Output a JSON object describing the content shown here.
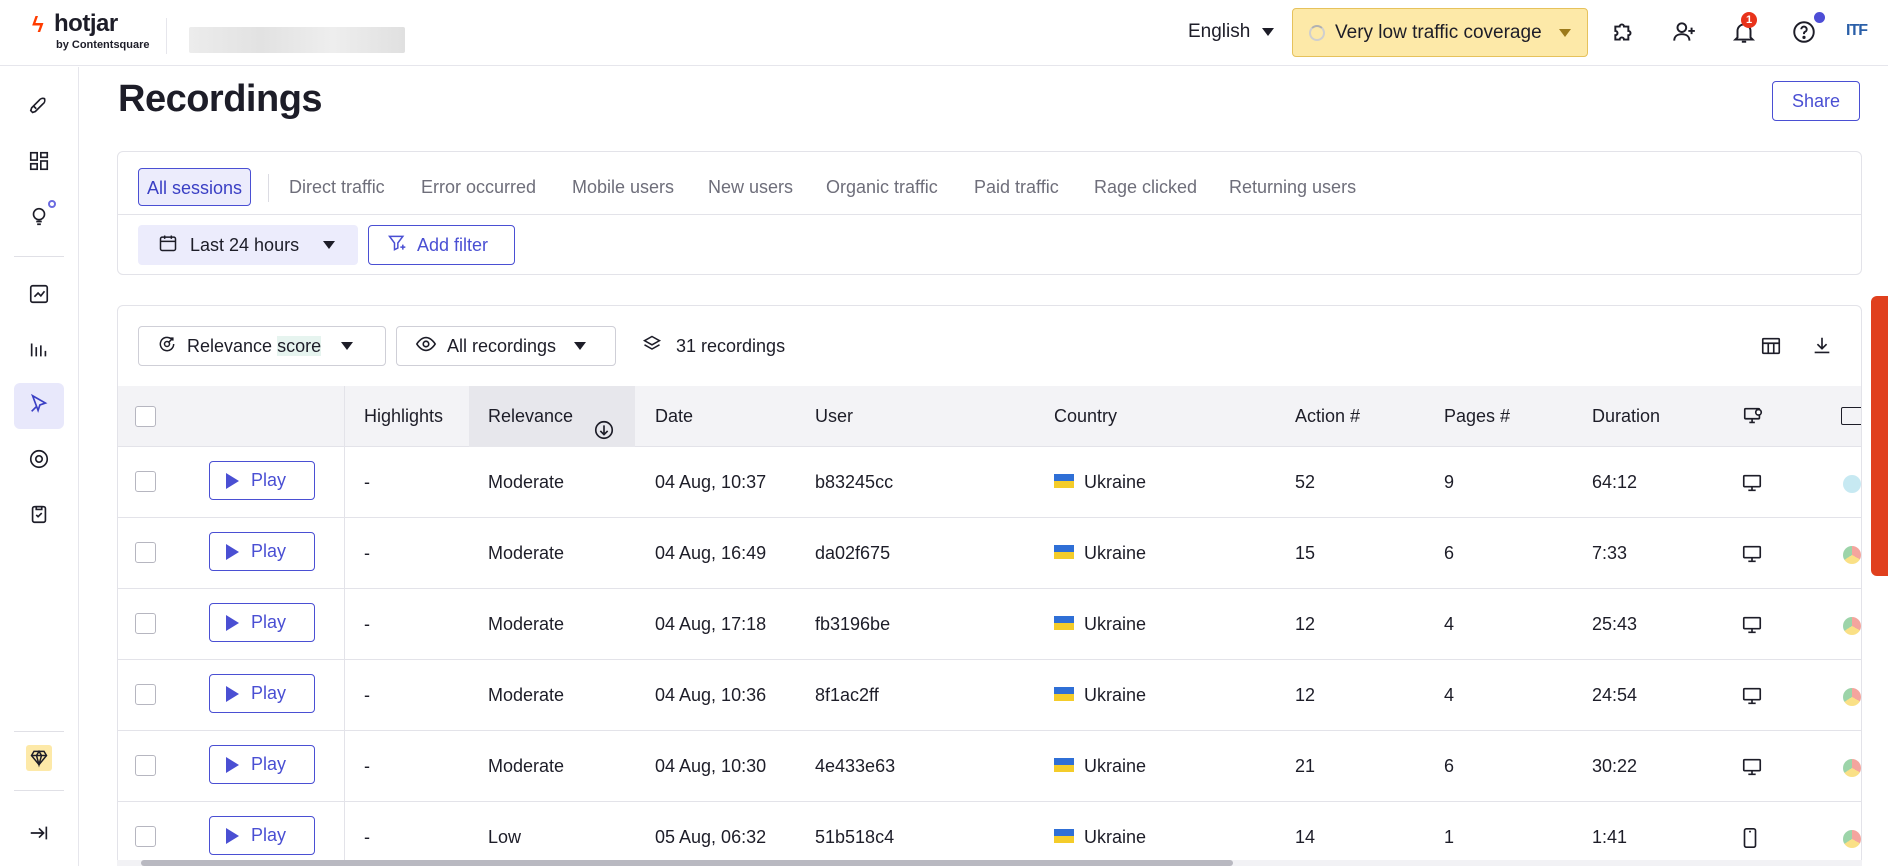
{
  "header": {
    "brand": "hotjar",
    "brand_sub": "by Contentsquare",
    "language": "English",
    "traffic_coverage": "Very low traffic coverage",
    "notifications_count": "1",
    "org_initials": "ITF"
  },
  "sidebar": {
    "items": [
      {
        "icon": "rocket-icon"
      },
      {
        "icon": "dashboard-icon"
      },
      {
        "icon": "lightbulb-icon"
      },
      {
        "icon": "trends-icon"
      },
      {
        "icon": "bar-chart-icon"
      },
      {
        "icon": "recordings-icon",
        "active": true
      },
      {
        "icon": "feedback-icon"
      },
      {
        "icon": "survey-icon"
      },
      {
        "icon": "diamond-icon"
      },
      {
        "icon": "collapse-icon"
      }
    ]
  },
  "page": {
    "title": "Recordings",
    "share_label": "Share"
  },
  "segments": {
    "tabs": [
      "All sessions",
      "Direct traffic",
      "Error occurred",
      "Mobile users",
      "New users",
      "Organic traffic",
      "Paid traffic",
      "Rage clicked",
      "Returning users"
    ],
    "active": "All sessions",
    "date_range": "Last 24 hours",
    "add_filter": "Add filter"
  },
  "toolbar": {
    "sort_label_1": "Relevance",
    "sort_label_2": "score",
    "view_filter": "All recordings",
    "recordings_count": "31 recordings"
  },
  "table": {
    "columns": [
      "Highlights",
      "Relevance",
      "Date",
      "User",
      "Country",
      "Action #",
      "Pages #",
      "Duration"
    ],
    "play_label": "Play",
    "rows": [
      {
        "highlights": "-",
        "relevance": "Moderate",
        "date": "04 Aug, 10:37",
        "user": "b83245cc",
        "country": "Ukraine",
        "actions": "52",
        "pages": "9",
        "duration": "64:12",
        "device": "desktop"
      },
      {
        "highlights": "-",
        "relevance": "Moderate",
        "date": "04 Aug, 16:49",
        "user": "da02f675",
        "country": "Ukraine",
        "actions": "15",
        "pages": "6",
        "duration": "7:33",
        "device": "desktop"
      },
      {
        "highlights": "-",
        "relevance": "Moderate",
        "date": "04 Aug, 17:18",
        "user": "fb3196be",
        "country": "Ukraine",
        "actions": "12",
        "pages": "4",
        "duration": "25:43",
        "device": "desktop"
      },
      {
        "highlights": "-",
        "relevance": "Moderate",
        "date": "04 Aug, 10:36",
        "user": "8f1ac2ff",
        "country": "Ukraine",
        "actions": "12",
        "pages": "4",
        "duration": "24:54",
        "device": "desktop"
      },
      {
        "highlights": "-",
        "relevance": "Moderate",
        "date": "04 Aug, 10:30",
        "user": "4e433e63",
        "country": "Ukraine",
        "actions": "21",
        "pages": "6",
        "duration": "30:22",
        "device": "desktop"
      },
      {
        "highlights": "-",
        "relevance": "Low",
        "date": "05 Aug, 06:32",
        "user": "51b518c4",
        "country": "Ukraine",
        "actions": "14",
        "pages": "1",
        "duration": "1:41",
        "device": "mobile"
      }
    ]
  },
  "colors": {
    "accent": "#4a4fd3",
    "traffic_bg": "#fde9a8",
    "brand_red": "#ff3c00"
  }
}
